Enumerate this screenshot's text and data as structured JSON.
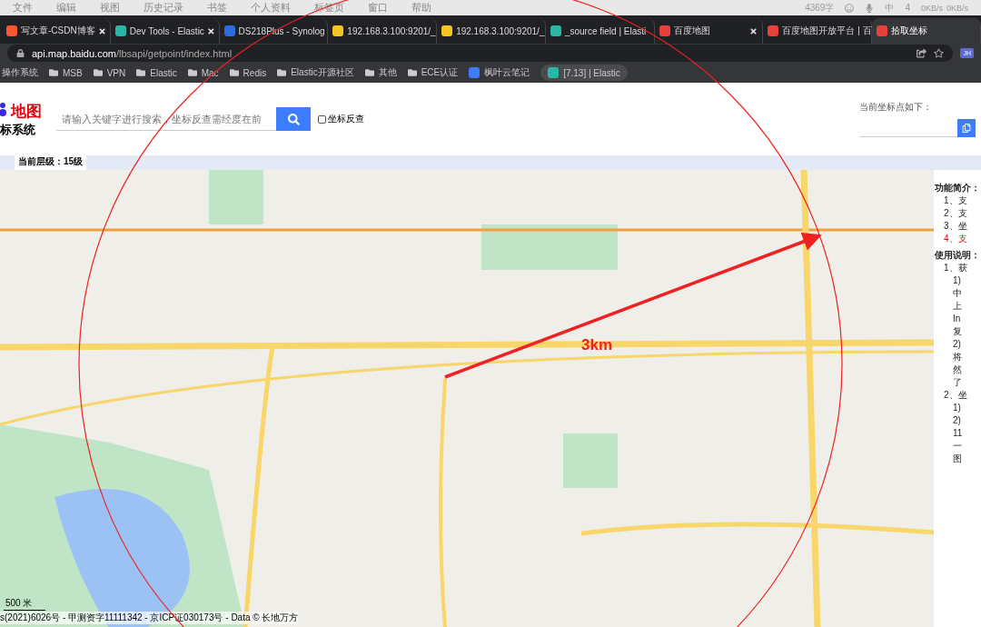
{
  "menu_bar": {
    "items": [
      "文件",
      "编辑",
      "视图",
      "历史记录",
      "书签",
      "个人资料",
      "标签页",
      "窗口",
      "帮助"
    ],
    "status": {
      "word_count": "4369字",
      "ime": "中",
      "badge": "4",
      "net_up": "0KB/s",
      "net_down": "0KB/s"
    }
  },
  "tabs": [
    {
      "title": "写文章-CSDN博客",
      "kind": "csdn",
      "selected": false
    },
    {
      "title": "Dev Tools - Elastic",
      "kind": "elastic",
      "selected": false
    },
    {
      "title": "DS218Plus - Synolog",
      "kind": "dsm",
      "selected": false
    },
    {
      "title": "192.168.3.100:9201/_",
      "kind": "es",
      "selected": false
    },
    {
      "title": "192.168.3.100:9201/_",
      "kind": "es",
      "selected": false
    },
    {
      "title": "_source field | Elasti",
      "kind": "elastic",
      "selected": false
    },
    {
      "title": "百度地图",
      "kind": "map",
      "selected": false
    },
    {
      "title": "百度地图开放平台 | 百",
      "kind": "map",
      "selected": false
    },
    {
      "title": "拾取坐标",
      "kind": "map",
      "selected": true
    }
  ],
  "address_bar": {
    "host": "api.map.baidu.com",
    "path": "/lbsapi/getpoint/index.html",
    "profile": "JH"
  },
  "bookmarks": [
    {
      "label": "操作系统",
      "kind": "plain"
    },
    {
      "label": "MSB",
      "kind": "folder"
    },
    {
      "label": "VPN",
      "kind": "folder"
    },
    {
      "label": "Elastic",
      "kind": "folder"
    },
    {
      "label": "Mac",
      "kind": "folder"
    },
    {
      "label": "Redis",
      "kind": "folder"
    },
    {
      "label": "Elastic开源社区",
      "kind": "folder"
    },
    {
      "label": "其他",
      "kind": "folder"
    },
    {
      "label": "ECE认证",
      "kind": "folder"
    },
    {
      "label": "枫叶云笔记",
      "kind": "note"
    },
    {
      "label": "[7.13] | Elastic",
      "kind": "elastic"
    }
  ],
  "page": {
    "logo": {
      "brand": "地图",
      "subtitle": "标系统"
    },
    "search": {
      "placeholder": "请输入关键字进行搜索，坐标反查需经度在前"
    },
    "reverse_lookup": {
      "label": "坐标反查",
      "checked": false
    },
    "coordinate": {
      "label": "当前坐标点如下："
    },
    "level_bar": {
      "label": "当前层级：15级"
    },
    "map": {
      "annotation": "3km",
      "scale": "500 米",
      "copyright": "s(2021)6026号 - 甲测资字11111342 - 京ICP证030173号 - Data © 长地万方"
    },
    "side_panel": [
      {
        "text": "功能简介：",
        "kind": "heading"
      },
      {
        "text": "1、支",
        "kind": "item"
      },
      {
        "text": "2、支",
        "kind": "item"
      },
      {
        "text": "3、坐",
        "kind": "item"
      },
      {
        "text": "4、支",
        "kind": "alert"
      },
      {
        "text": "使用说明：",
        "kind": "heading"
      },
      {
        "text": "1、获",
        "kind": "item"
      },
      {
        "text": "1)",
        "kind": "sub"
      },
      {
        "text": "中",
        "kind": "sub"
      },
      {
        "text": "上",
        "kind": "sub"
      },
      {
        "text": "In",
        "kind": "sub"
      },
      {
        "text": "复",
        "kind": "sub"
      },
      {
        "text": "2)",
        "kind": "sub"
      },
      {
        "text": "将",
        "kind": "sub"
      },
      {
        "text": "然",
        "kind": "sub"
      },
      {
        "text": "了",
        "kind": "sub"
      },
      {
        "text": "2、坐",
        "kind": "item"
      },
      {
        "text": "1)",
        "kind": "sub"
      },
      {
        "text": "2)",
        "kind": "sub"
      },
      {
        "text": "11",
        "kind": "sub"
      },
      {
        "text": "一",
        "kind": "sub"
      },
      {
        "text": "图",
        "kind": "sub"
      }
    ]
  }
}
